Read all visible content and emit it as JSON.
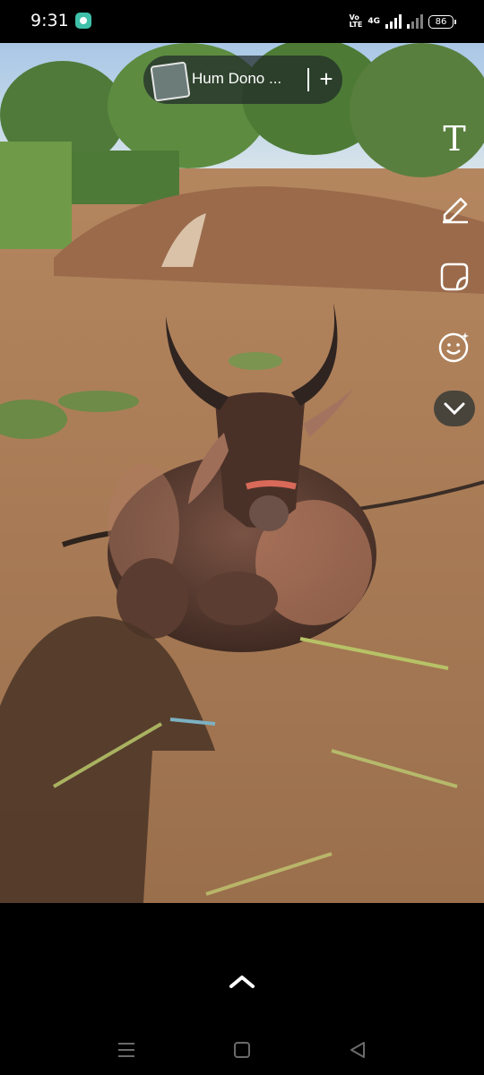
{
  "status_bar": {
    "time": "9:31",
    "volte_top": "Vo",
    "volte_bottom": "LTE",
    "network": "4G",
    "battery": "86"
  },
  "music": {
    "title": "Hum Dono ...",
    "add_symbol": "+"
  },
  "tools": {
    "text_glyph": "T",
    "icons": [
      "text-icon",
      "pen-icon",
      "sticker-icon",
      "emoji-icon",
      "chevron-down-icon"
    ]
  },
  "bottom": {
    "swipe_icon": "chevron-up-icon",
    "nav_icons": [
      "recents-icon",
      "home-icon",
      "back-icon"
    ]
  }
}
